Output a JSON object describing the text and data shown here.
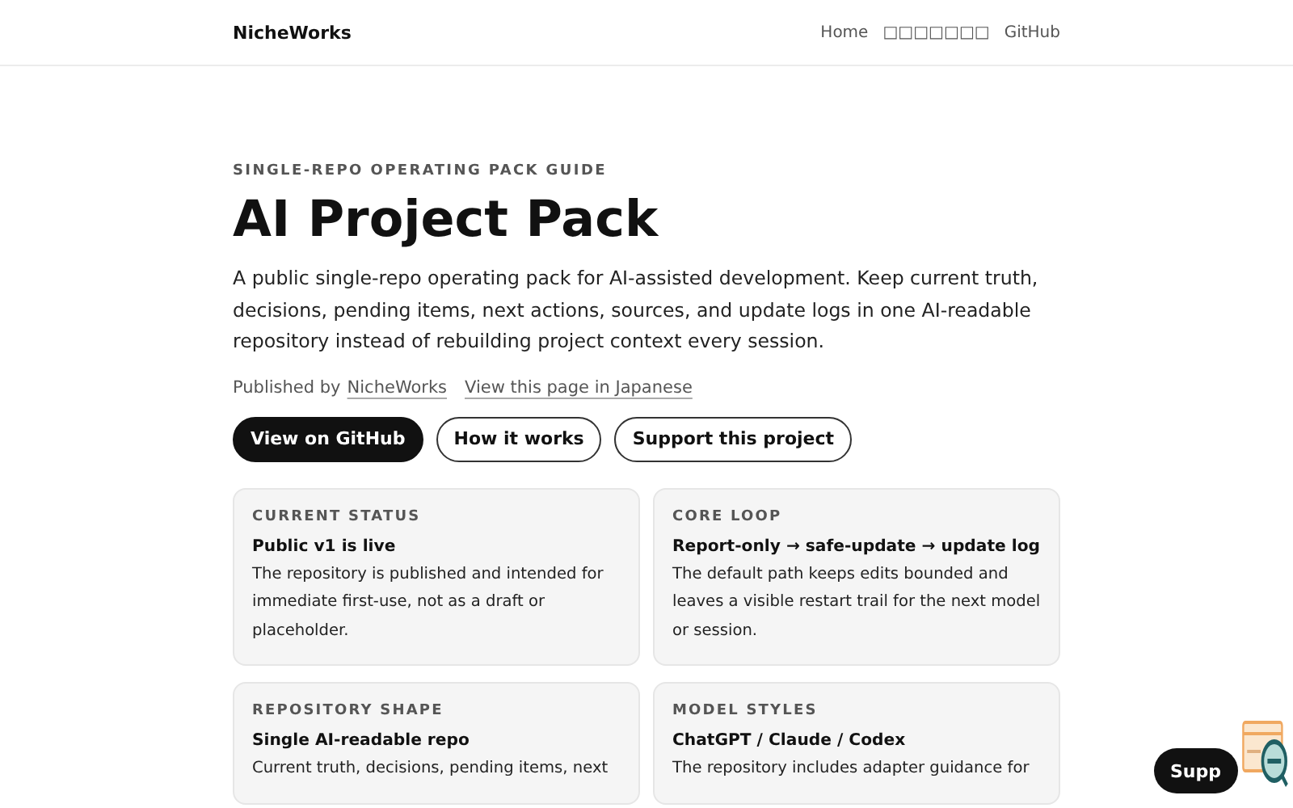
{
  "header": {
    "brand": "NicheWorks",
    "nav": [
      {
        "label": "Home"
      },
      {
        "label": "□□□□□□□"
      },
      {
        "label": "GitHub"
      }
    ]
  },
  "hero": {
    "eyebrow": "SINGLE-REPO OPERATING PACK GUIDE",
    "title": "AI Project Pack",
    "lead": "A public single-repo operating pack for AI-assisted development. Keep current truth, decisions, pending items, next actions, sources, and update logs in one AI-readable repository instead of rebuilding project context every session.",
    "published_prefix": "Published by",
    "publisher": "NicheWorks",
    "japanese_link": "View this page in Japanese",
    "buttons": [
      {
        "label": "View on GitHub",
        "kind": "primary"
      },
      {
        "label": "How it works",
        "kind": "secondary"
      },
      {
        "label": "Support this project",
        "kind": "secondary"
      }
    ]
  },
  "cards": [
    {
      "eyebrow": "CURRENT STATUS",
      "title": "Public v1 is live",
      "body": "The repository is published and intended for immediate first-use, not as a draft or placeholder."
    },
    {
      "eyebrow": "CORE LOOP",
      "title": "Report-only → safe-update → update log",
      "body": "The default path keeps edits bounded and leaves a visible restart trail for the next model or session."
    },
    {
      "eyebrow": "REPOSITORY SHAPE",
      "title": "Single AI-readable repo",
      "body": "Current truth, decisions, pending items, next"
    },
    {
      "eyebrow": "MODEL STYLES",
      "title": "ChatGPT / Claude / Codex",
      "body": "The repository includes adapter guidance for"
    }
  ],
  "floating_button": {
    "label": "Supp"
  }
}
